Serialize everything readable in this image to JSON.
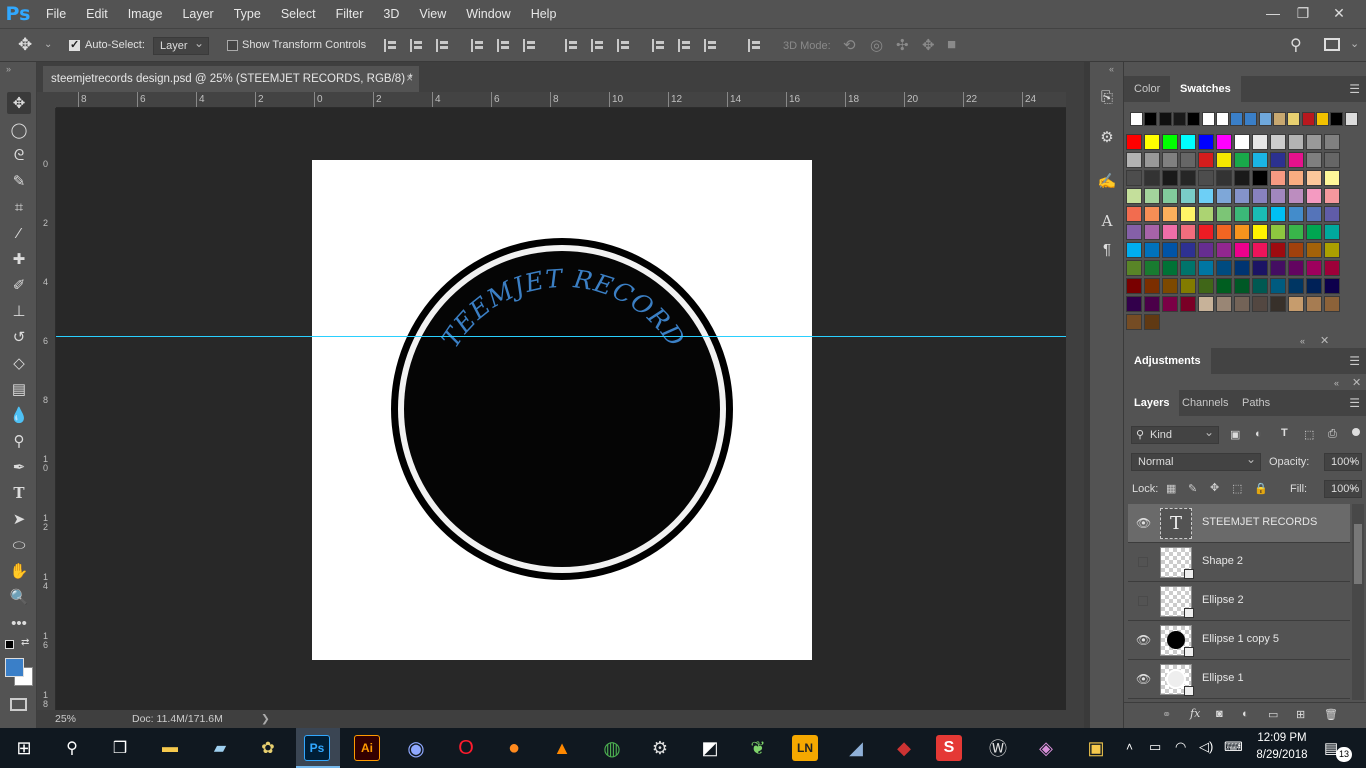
{
  "app": {
    "logo": "Ps",
    "menu": [
      "File",
      "Edit",
      "Image",
      "Layer",
      "Type",
      "Select",
      "Filter",
      "3D",
      "View",
      "Window",
      "Help"
    ],
    "window_controls": [
      "—",
      "❐",
      "✕"
    ]
  },
  "options_bar": {
    "auto_select_label": "Auto-Select:",
    "auto_select_checked": true,
    "auto_select_target": "Layer",
    "show_transform_label": "Show Transform Controls",
    "mode_3d_label": "3D Mode:"
  },
  "document": {
    "tab_title": "steemjetrecords design.psd @ 25% (STEEMJET RECORDS, RGB/8) *",
    "close_glyph": "×",
    "canvas_text": "STEEMJET RECORDS",
    "canvas_text_color": "#3b7fc4"
  },
  "rulers": {
    "top": [
      "8",
      "6",
      "4",
      "2",
      "0",
      "2",
      "4",
      "6",
      "8",
      "10",
      "12",
      "14",
      "16",
      "18",
      "20",
      "22",
      "24"
    ],
    "left": [
      "0",
      "2",
      "4",
      "6",
      "8",
      "10",
      "12",
      "14",
      "16",
      "18"
    ]
  },
  "status": {
    "zoom": "25%",
    "doc_size": "Doc: 11.4M/171.6M",
    "arrow": "❯"
  },
  "panels": {
    "color_tabs": [
      "Color",
      "Swatches"
    ],
    "active_color_tab": "Swatches",
    "adjustments_label": "Adjustments",
    "layer_tabs": [
      "Layers",
      "Channels",
      "Paths"
    ],
    "active_layer_tab": "Layers",
    "kind_filter": "Kind",
    "blend_mode": "Normal",
    "opacity_label": "Opacity:",
    "opacity_value": "100%",
    "lock_label": "Lock:",
    "fill_label": "Fill:",
    "fill_value": "100%"
  },
  "layers": [
    {
      "name": "STEEMJET RECORDS",
      "visible": true,
      "type": "text",
      "selected": true
    },
    {
      "name": "Shape 2",
      "visible": false,
      "type": "shape",
      "selected": false
    },
    {
      "name": "Ellipse 2",
      "visible": false,
      "type": "shape",
      "selected": false
    },
    {
      "name": "Ellipse 1 copy 5",
      "visible": true,
      "type": "shape",
      "selected": false
    },
    {
      "name": "Ellipse 1",
      "visible": true,
      "type": "shape",
      "selected": false
    }
  ],
  "swatch_rows": [
    [
      "#ffffff",
      "#000000",
      "#101010",
      "#1a1a1a",
      "#000000",
      "#ffffff",
      "#ffffff",
      "#3a7fc8",
      "#3a7fc8",
      "#6fa8dc",
      "#c8a870",
      "#e8d070",
      "#b8181e",
      "#f2c200",
      "#000000",
      "#dcdcdc"
    ],
    [
      "#ff0000",
      "#ffff00",
      "#00ff00",
      "#00ffff",
      "#0000ff",
      "#ff00ff",
      "#ffffff",
      "#e6e6e6",
      "#cccccc",
      "#b3b3b3",
      "#999999",
      "#808080"
    ],
    [
      "#b3b3b3",
      "#999999",
      "#808080",
      "#666666",
      "#d41c1c",
      "#f5e800",
      "#19a84a",
      "#1ab4e6",
      "#2c3190",
      "#e6128c",
      "#7f7f7f",
      "#666666"
    ],
    [
      "#4d4d4d",
      "#333333",
      "#1a1a1a",
      "#262626",
      "#4d4d4d",
      "#333333",
      "#1a1a1a",
      "#000000",
      "#f79a82",
      "#f9ad81",
      "#fcc89b",
      "#fff799"
    ],
    [
      "#c4df9b",
      "#a3d39c",
      "#82ca9c",
      "#7accc8",
      "#6dcff6",
      "#7ea7d8",
      "#8493ca",
      "#8882be",
      "#a187be",
      "#bc8dbf",
      "#f49ac1",
      "#f5989d"
    ],
    [
      "#f26c4f",
      "#f68e55",
      "#fbaf5c",
      "#fff467",
      "#acd372",
      "#7cc576",
      "#3bb878",
      "#1abbb4",
      "#00bff3",
      "#438ccb",
      "#5574b9",
      "#605ca8"
    ],
    [
      "#8560a8",
      "#a763a8",
      "#f06ea9",
      "#f26d7d",
      "#ed1c24",
      "#f26522",
      "#f7941d",
      "#fff200",
      "#8dc63f",
      "#39b54a",
      "#00a651",
      "#00a99d"
    ],
    [
      "#00aeef",
      "#0072bc",
      "#0054a6",
      "#2e3192",
      "#662d91",
      "#92278f",
      "#ec008c",
      "#ed145b",
      "#9e0b0f",
      "#a0410d",
      "#a36209",
      "#aba000"
    ],
    [
      "#598527",
      "#197b30",
      "#007236",
      "#00746b",
      "#0076a3",
      "#004b80",
      "#003471",
      "#1b1464",
      "#440e62",
      "#630460",
      "#9e005d",
      "#9e0039"
    ],
    [
      "#790000",
      "#7b2e00",
      "#7d4900",
      "#827b00",
      "#406618",
      "#005e20",
      "#005826",
      "#005952",
      "#005b7f",
      "#003663",
      "#002157",
      "#0d004c"
    ],
    [
      "#32004b",
      "#4b0049",
      "#7b0046",
      "#7a0026",
      "#c7b299",
      "#998675",
      "#736357",
      "#534741",
      "#37302a",
      "#c69c6d",
      "#a67c52",
      "#8c6239"
    ],
    [
      "#754c24",
      "#603913"
    ]
  ],
  "toolbar": {
    "tools": [
      "move-tool",
      "ellipse-marquee-tool",
      "lasso-tool",
      "quick-select-tool",
      "crop-tool",
      "eyedropper-tool",
      "healing-tool",
      "brush-tool",
      "clone-stamp-tool",
      "history-brush-tool",
      "eraser-tool",
      "gradient-tool",
      "blur-tool",
      "dodge-tool",
      "pen-tool",
      "type-tool",
      "path-select-tool",
      "ellipse-tool",
      "hand-tool",
      "zoom-tool",
      "more-tools"
    ],
    "foreground_color": "#3a7fc8",
    "background_color": "#ffffff"
  },
  "taskbar": {
    "time": "12:09 PM",
    "date": "8/29/2018",
    "notifications": "13"
  }
}
